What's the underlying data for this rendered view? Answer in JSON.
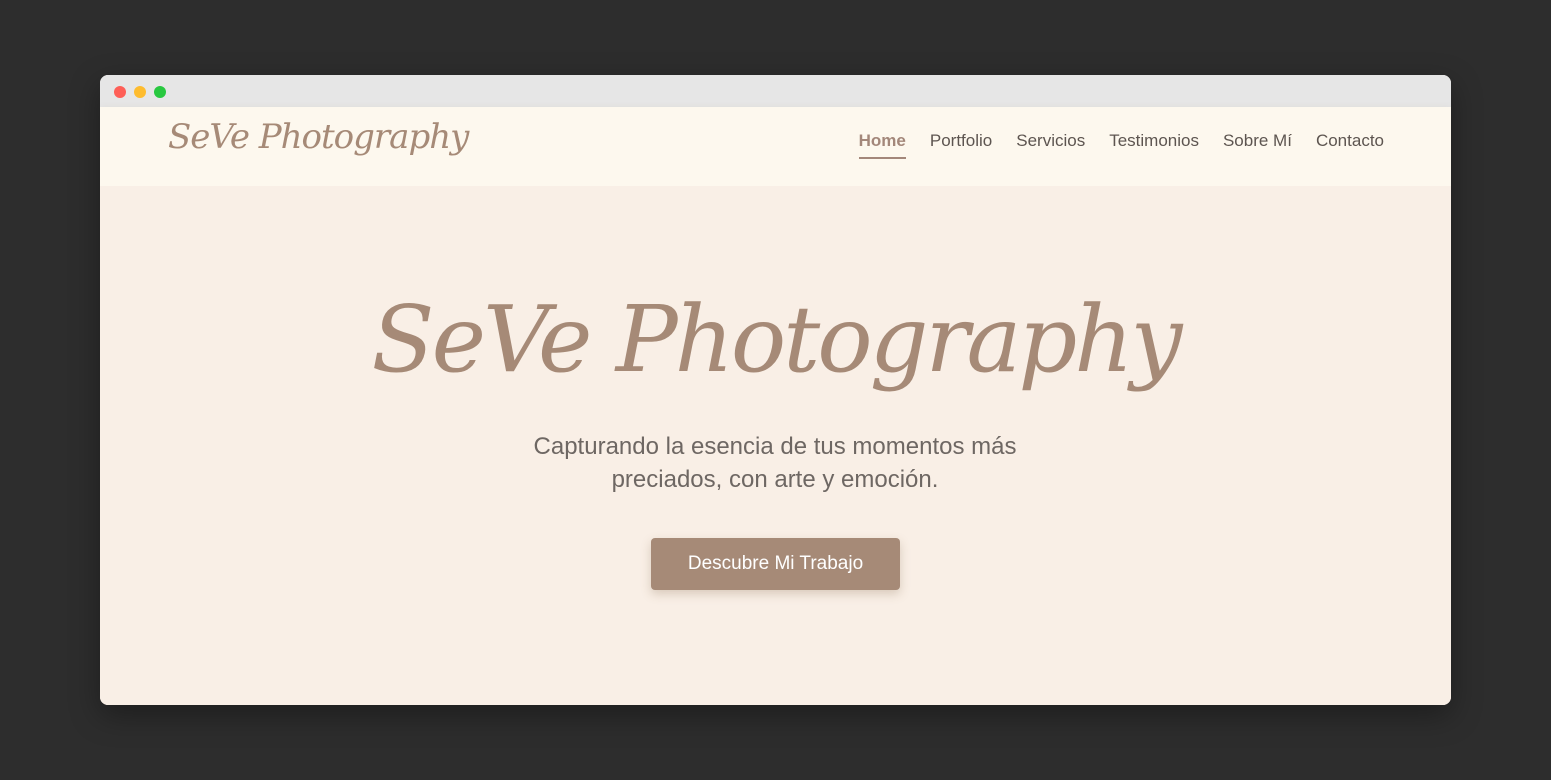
{
  "window": {
    "controls": [
      "close",
      "minimize",
      "maximize"
    ]
  },
  "header": {
    "logo": "SeVe Photography",
    "nav": [
      {
        "label": "Home",
        "active": true
      },
      {
        "label": "Portfolio",
        "active": false
      },
      {
        "label": "Servicios",
        "active": false
      },
      {
        "label": "Testimonios",
        "active": false
      },
      {
        "label": "Sobre Mí",
        "active": false
      },
      {
        "label": "Contacto",
        "active": false
      }
    ]
  },
  "hero": {
    "title": "SeVe Photography",
    "subtitle": "Capturando la esencia de tus momentos más preciados, con arte y emoción.",
    "cta_label": "Descubre Mi Trabajo"
  },
  "colors": {
    "accent": "#a68a77",
    "background": "#f9efe6",
    "header_background": "#fdf8ee",
    "text": "#6e6763"
  }
}
